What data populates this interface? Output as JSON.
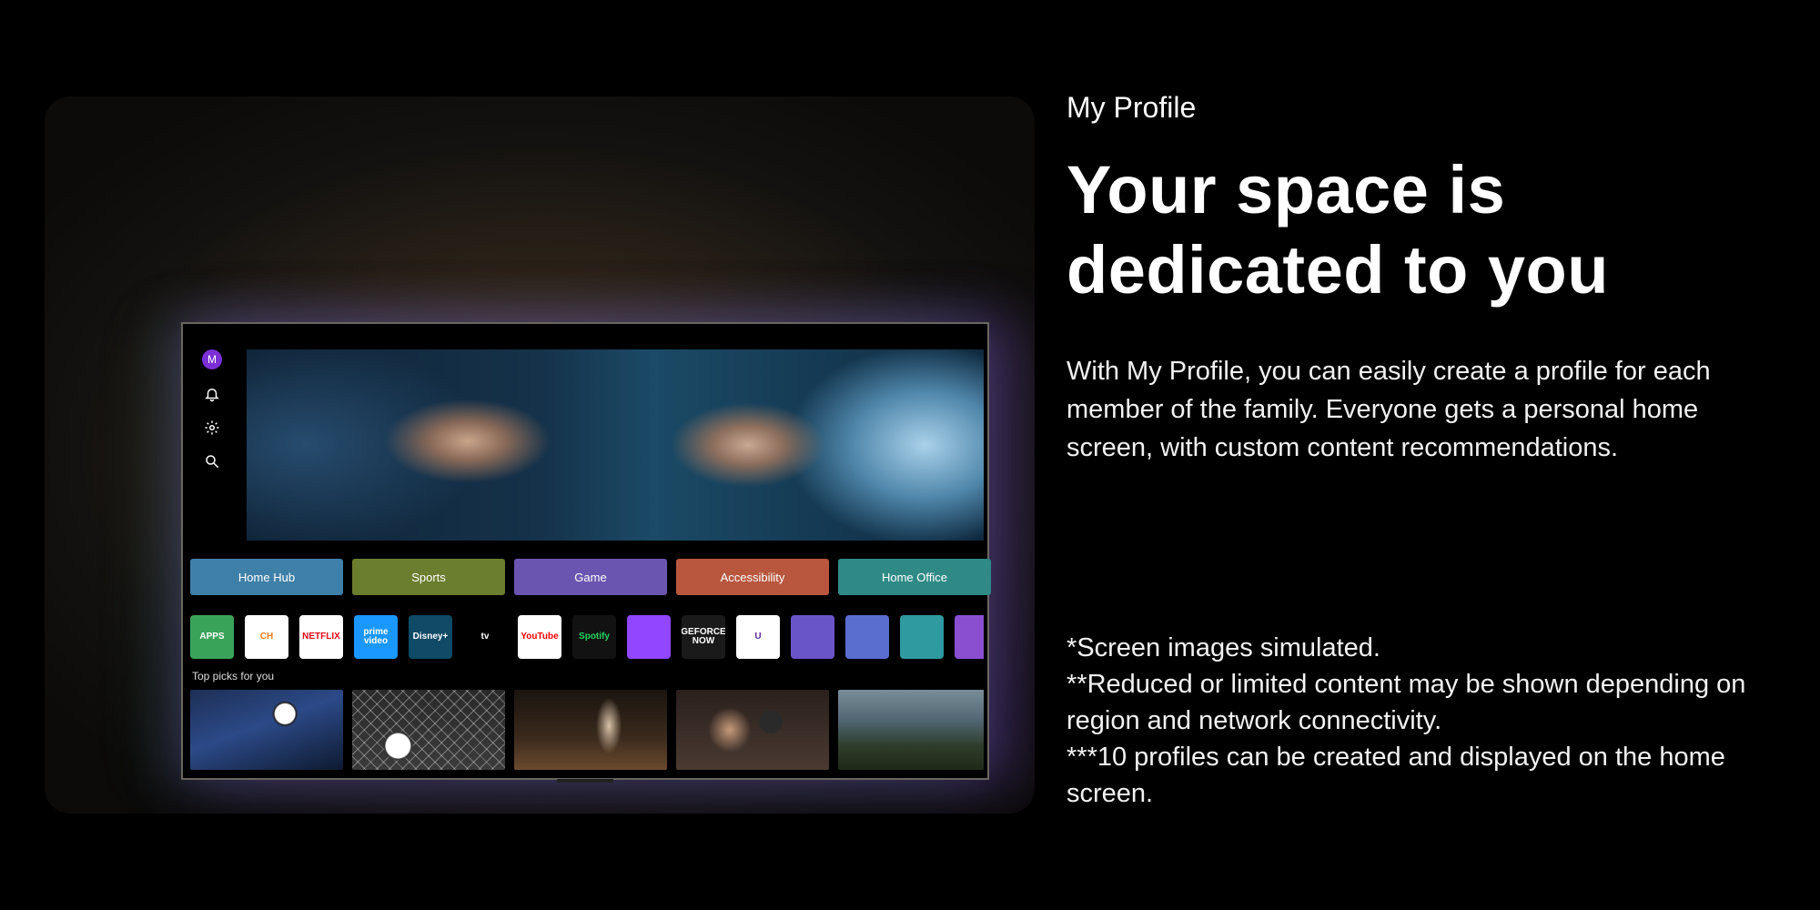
{
  "section_label": "My Profile",
  "headline_line1": "Your space is",
  "headline_line2": "dedicated to you",
  "description": "With My Profile, you can easily create a profile for each member of the family. Everyone gets a personal home screen, with custom content recommendations.",
  "notes": [
    "*Screen images simulated.",
    "**Reduced or limited content may be shown depending on region and network connectivity.",
    "***10 profiles can be created and displayed on the home screen."
  ],
  "tv": {
    "profile_initial": "M",
    "nav_icons": [
      "bell-icon",
      "gear-icon",
      "search-icon"
    ],
    "categories": [
      {
        "label": "Home Hub",
        "color": "#3f80a8"
      },
      {
        "label": "Sports",
        "color": "#6b7d2e"
      },
      {
        "label": "Game",
        "color": "#6a55b0"
      },
      {
        "label": "Accessibility",
        "color": "#b8573e"
      },
      {
        "label": "Home Office",
        "color": "#2f8a86"
      }
    ],
    "apps": [
      {
        "label": "APPS",
        "bg": "#3aa35a",
        "fg": "#ffffff"
      },
      {
        "label": "CH",
        "bg": "#ffffff",
        "fg": "#f07a1a"
      },
      {
        "label": "NETFLIX",
        "bg": "#ffffff",
        "fg": "#e50914"
      },
      {
        "label": "prime video",
        "bg": "#1a98ff",
        "fg": "#ffffff"
      },
      {
        "label": "Disney+",
        "bg": "#0f4a66",
        "fg": "#ffffff"
      },
      {
        "label": "tv",
        "bg": "#000000",
        "fg": "#ffffff"
      },
      {
        "label": "YouTube",
        "bg": "#ffffff",
        "fg": "#ff0000"
      },
      {
        "label": "Spotify",
        "bg": "#121212",
        "fg": "#1ed760"
      },
      {
        "label": "",
        "bg": "#9146ff",
        "fg": "#ffffff"
      },
      {
        "label": "GEFORCE NOW",
        "bg": "#1a1a1a",
        "fg": "#ffffff"
      },
      {
        "label": "U",
        "bg": "#ffffff",
        "fg": "#5a2d9a"
      },
      {
        "label": "",
        "bg": "#6a55c8",
        "fg": "#ffffff"
      },
      {
        "label": "",
        "bg": "#5a6ed0",
        "fg": "#ffffff"
      },
      {
        "label": "",
        "bg": "#2f9aa0",
        "fg": "#ffffff"
      },
      {
        "label": "",
        "bg": "#8a4fd0",
        "fg": "#ffffff"
      }
    ],
    "top_picks_label": "Top picks for you",
    "top_picks": [
      {
        "name": "soccer-kick-thumbnail",
        "gradient": "radial-gradient(circle at 62% 30%, #ffffff 0 9%, #222 10%, rgba(0,0,0,0) 12%), linear-gradient(160deg, #1d2f55 0%, #2c4a88 45%, #0e1a30 100%)"
      },
      {
        "name": "soccer-goal-thumbnail",
        "gradient": "radial-gradient(circle at 30% 70%, #ffffff 0 10%, #333 11%, rgba(0,0,0,0) 13%), repeating-linear-gradient(45deg, rgba(255,255,255,0.35) 0 1px, rgba(0,0,0,0) 1px 10px), repeating-linear-gradient(-45deg, rgba(255,255,255,0.35) 0 1px, rgba(0,0,0,0) 1px 10px), linear-gradient(180deg, #2a2a2a 0%, #3b3b3b 100%)"
      },
      {
        "name": "basketball-thumbnail",
        "gradient": "radial-gradient(ellipse 12% 50% at 62% 45%, #d8c2a8 0%, rgba(0,0,0,0) 70%), linear-gradient(180deg, #1a1410 0%, #3a2a1c 60%, #6b4a2e 100%)"
      },
      {
        "name": "boxing-thumbnail",
        "gradient": "radial-gradient(ellipse 20% 40% at 35% 50%, #c79a7a 0%, rgba(0,0,0,0) 70%), radial-gradient(circle at 62% 40%, #2a2a2a 0 10%, rgba(0,0,0,0) 12%), linear-gradient(180deg, #2a201c 0%, #4a3a32 100%)"
      },
      {
        "name": "american-football-thumbnail",
        "gradient": "linear-gradient(180deg, #7a8e9a 0%, #4f6470 40%, #2e3d2a 70%, #1e2a18 100%)"
      }
    ]
  }
}
